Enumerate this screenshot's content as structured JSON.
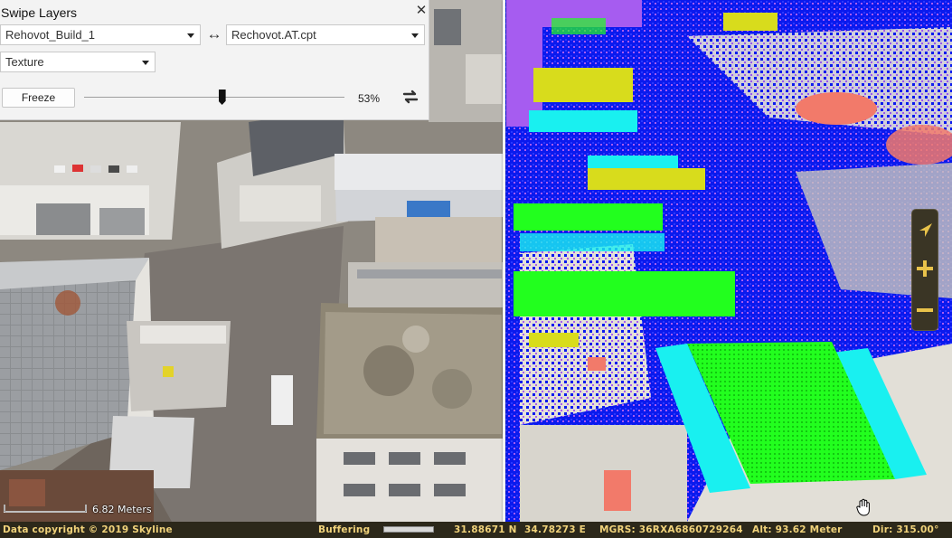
{
  "panel": {
    "title": "Swipe Layers",
    "close_glyph": "✕",
    "left_layer": "Rehovot_Build_1",
    "swap_glyph": "↔",
    "right_layer": "Rechovot.AT.cpt",
    "mode": "Texture",
    "freeze_label": "Freeze",
    "swipe_fraction": 0.53,
    "swipe_percent_text": "53%",
    "refresh_icon": "refresh-icon"
  },
  "nav": {
    "north_icon": "compass-arrow-icon",
    "zoom_in_icon": "plus-icon",
    "zoom_out_icon": "minus-icon"
  },
  "scale": {
    "label": "6.82 Meters"
  },
  "status": {
    "copyright": "Data copyright © 2019 Skyline",
    "buffering": "Buffering",
    "latitude": "31.88671 N",
    "longitude": "34.78273 E",
    "mgrs": "MGRS: 36RXA6860729264",
    "altitude": "Alt: 93.62 Meter",
    "direction": "Dir: 315.00°"
  },
  "colors": {
    "panel_bg": "#f3f3f3",
    "status_bg": "#2c281a",
    "status_text": "#f0d27a",
    "nav_bg": "#3a3525",
    "nav_icon": "#e8c24a",
    "cloud_blue": "#0a1aee",
    "cloud_green": "#22ff1e",
    "cloud_cyan": "#19f0f0",
    "cloud_yellow": "#d8dc1c",
    "cloud_violet": "#a65cf0",
    "cloud_salmon": "#f27a6a"
  }
}
